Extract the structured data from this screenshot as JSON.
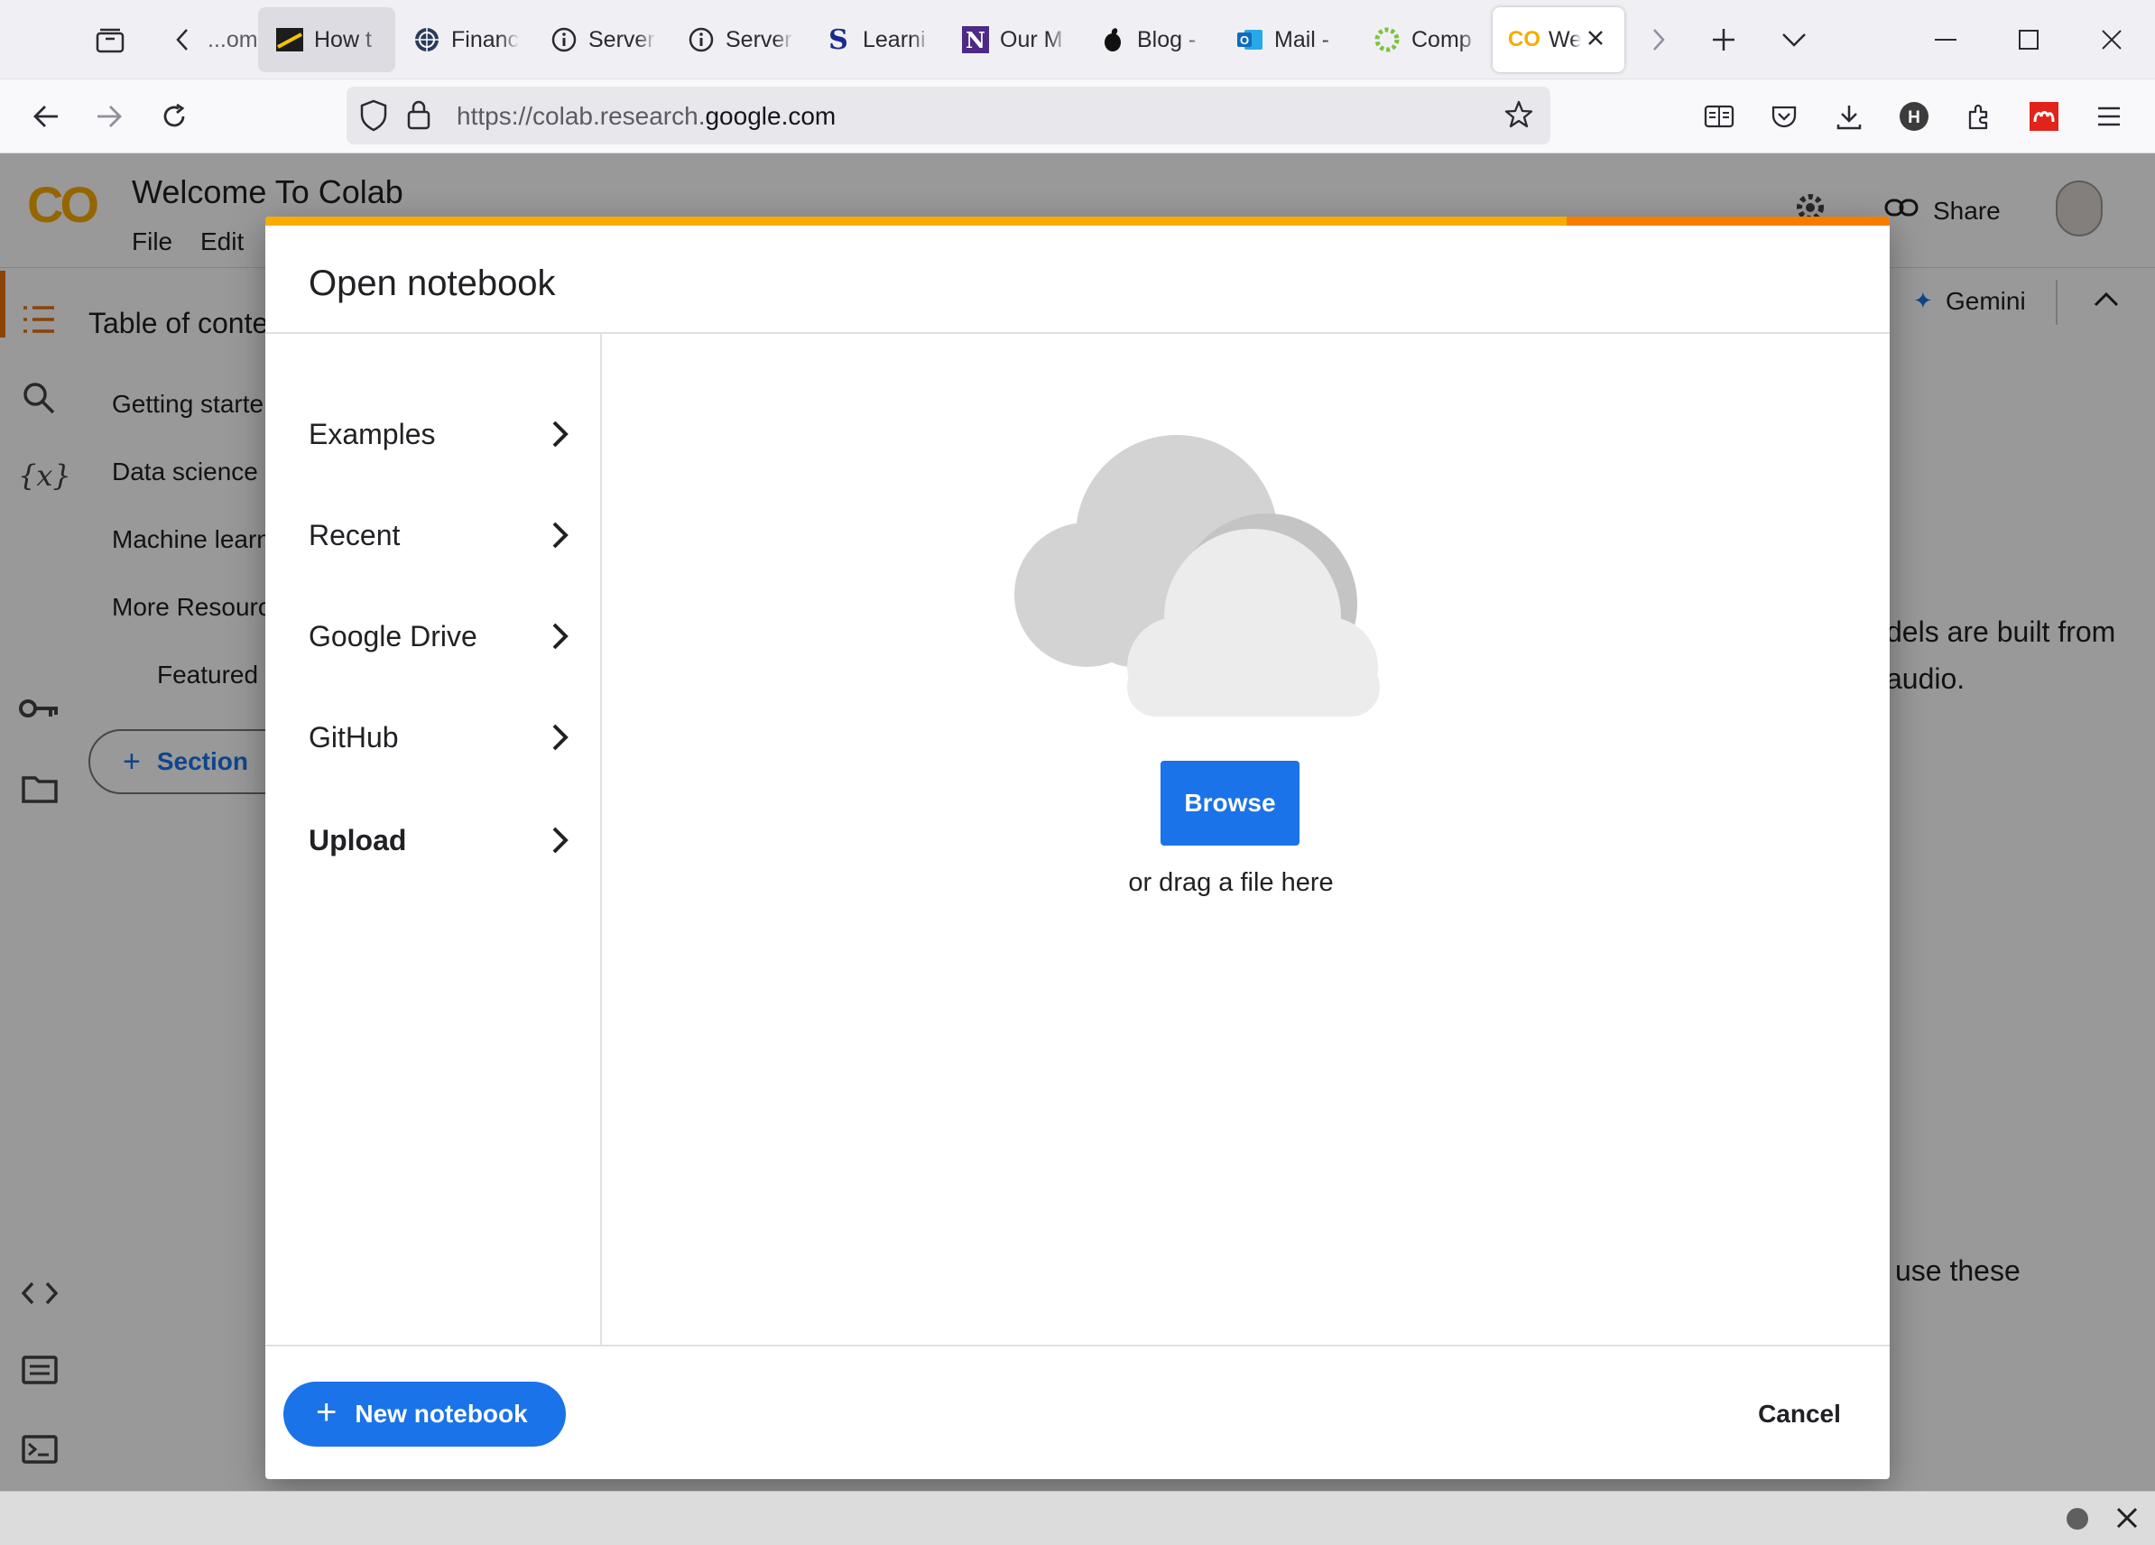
{
  "browser": {
    "tabs": [
      {
        "title": "...om",
        "favicon": "generic"
      },
      {
        "title": "How t",
        "favicon": "slash-icon"
      },
      {
        "title": "Financ",
        "favicon": "globe-icon"
      },
      {
        "title": "Server",
        "favicon": "info-icon"
      },
      {
        "title": "Server",
        "favicon": "info-icon"
      },
      {
        "title": "Learni",
        "favicon": "s-logo"
      },
      {
        "title": "Our M",
        "favicon": "n-logo"
      },
      {
        "title": "Blog -",
        "favicon": "apple-icon"
      },
      {
        "title": "Mail -",
        "favicon": "outlook-icon"
      },
      {
        "title": "Comp",
        "favicon": "c-logo"
      },
      {
        "title": "We",
        "favicon": "colab-icon"
      }
    ],
    "url_prefix": "https://colab.research.",
    "url_domain": "google.com",
    "accent_color": "#f9ab00"
  },
  "colab": {
    "logo": "CO",
    "notebook_title": "Welcome To Colab",
    "menu": [
      "File",
      "Edit"
    ],
    "share_label": "Share",
    "gemini_label": "Gemini",
    "toc_title": "Table of conte",
    "toc_items": [
      "Getting starte",
      "Data science",
      "Machine learn",
      "More Resourc",
      "Featured"
    ],
    "section_button": "Section",
    "body_text_1": "dels are built from",
    "body_text_2": "audio.",
    "body_text_3": "use these"
  },
  "dialog": {
    "title": "Open notebook",
    "nav_items": [
      "Examples",
      "Recent",
      "Google Drive",
      "GitHub",
      "Upload"
    ],
    "selected_item": "Upload",
    "browse_label": "Browse",
    "drag_text": "or drag a file here",
    "new_notebook_label": "New notebook",
    "cancel_label": "Cancel"
  }
}
